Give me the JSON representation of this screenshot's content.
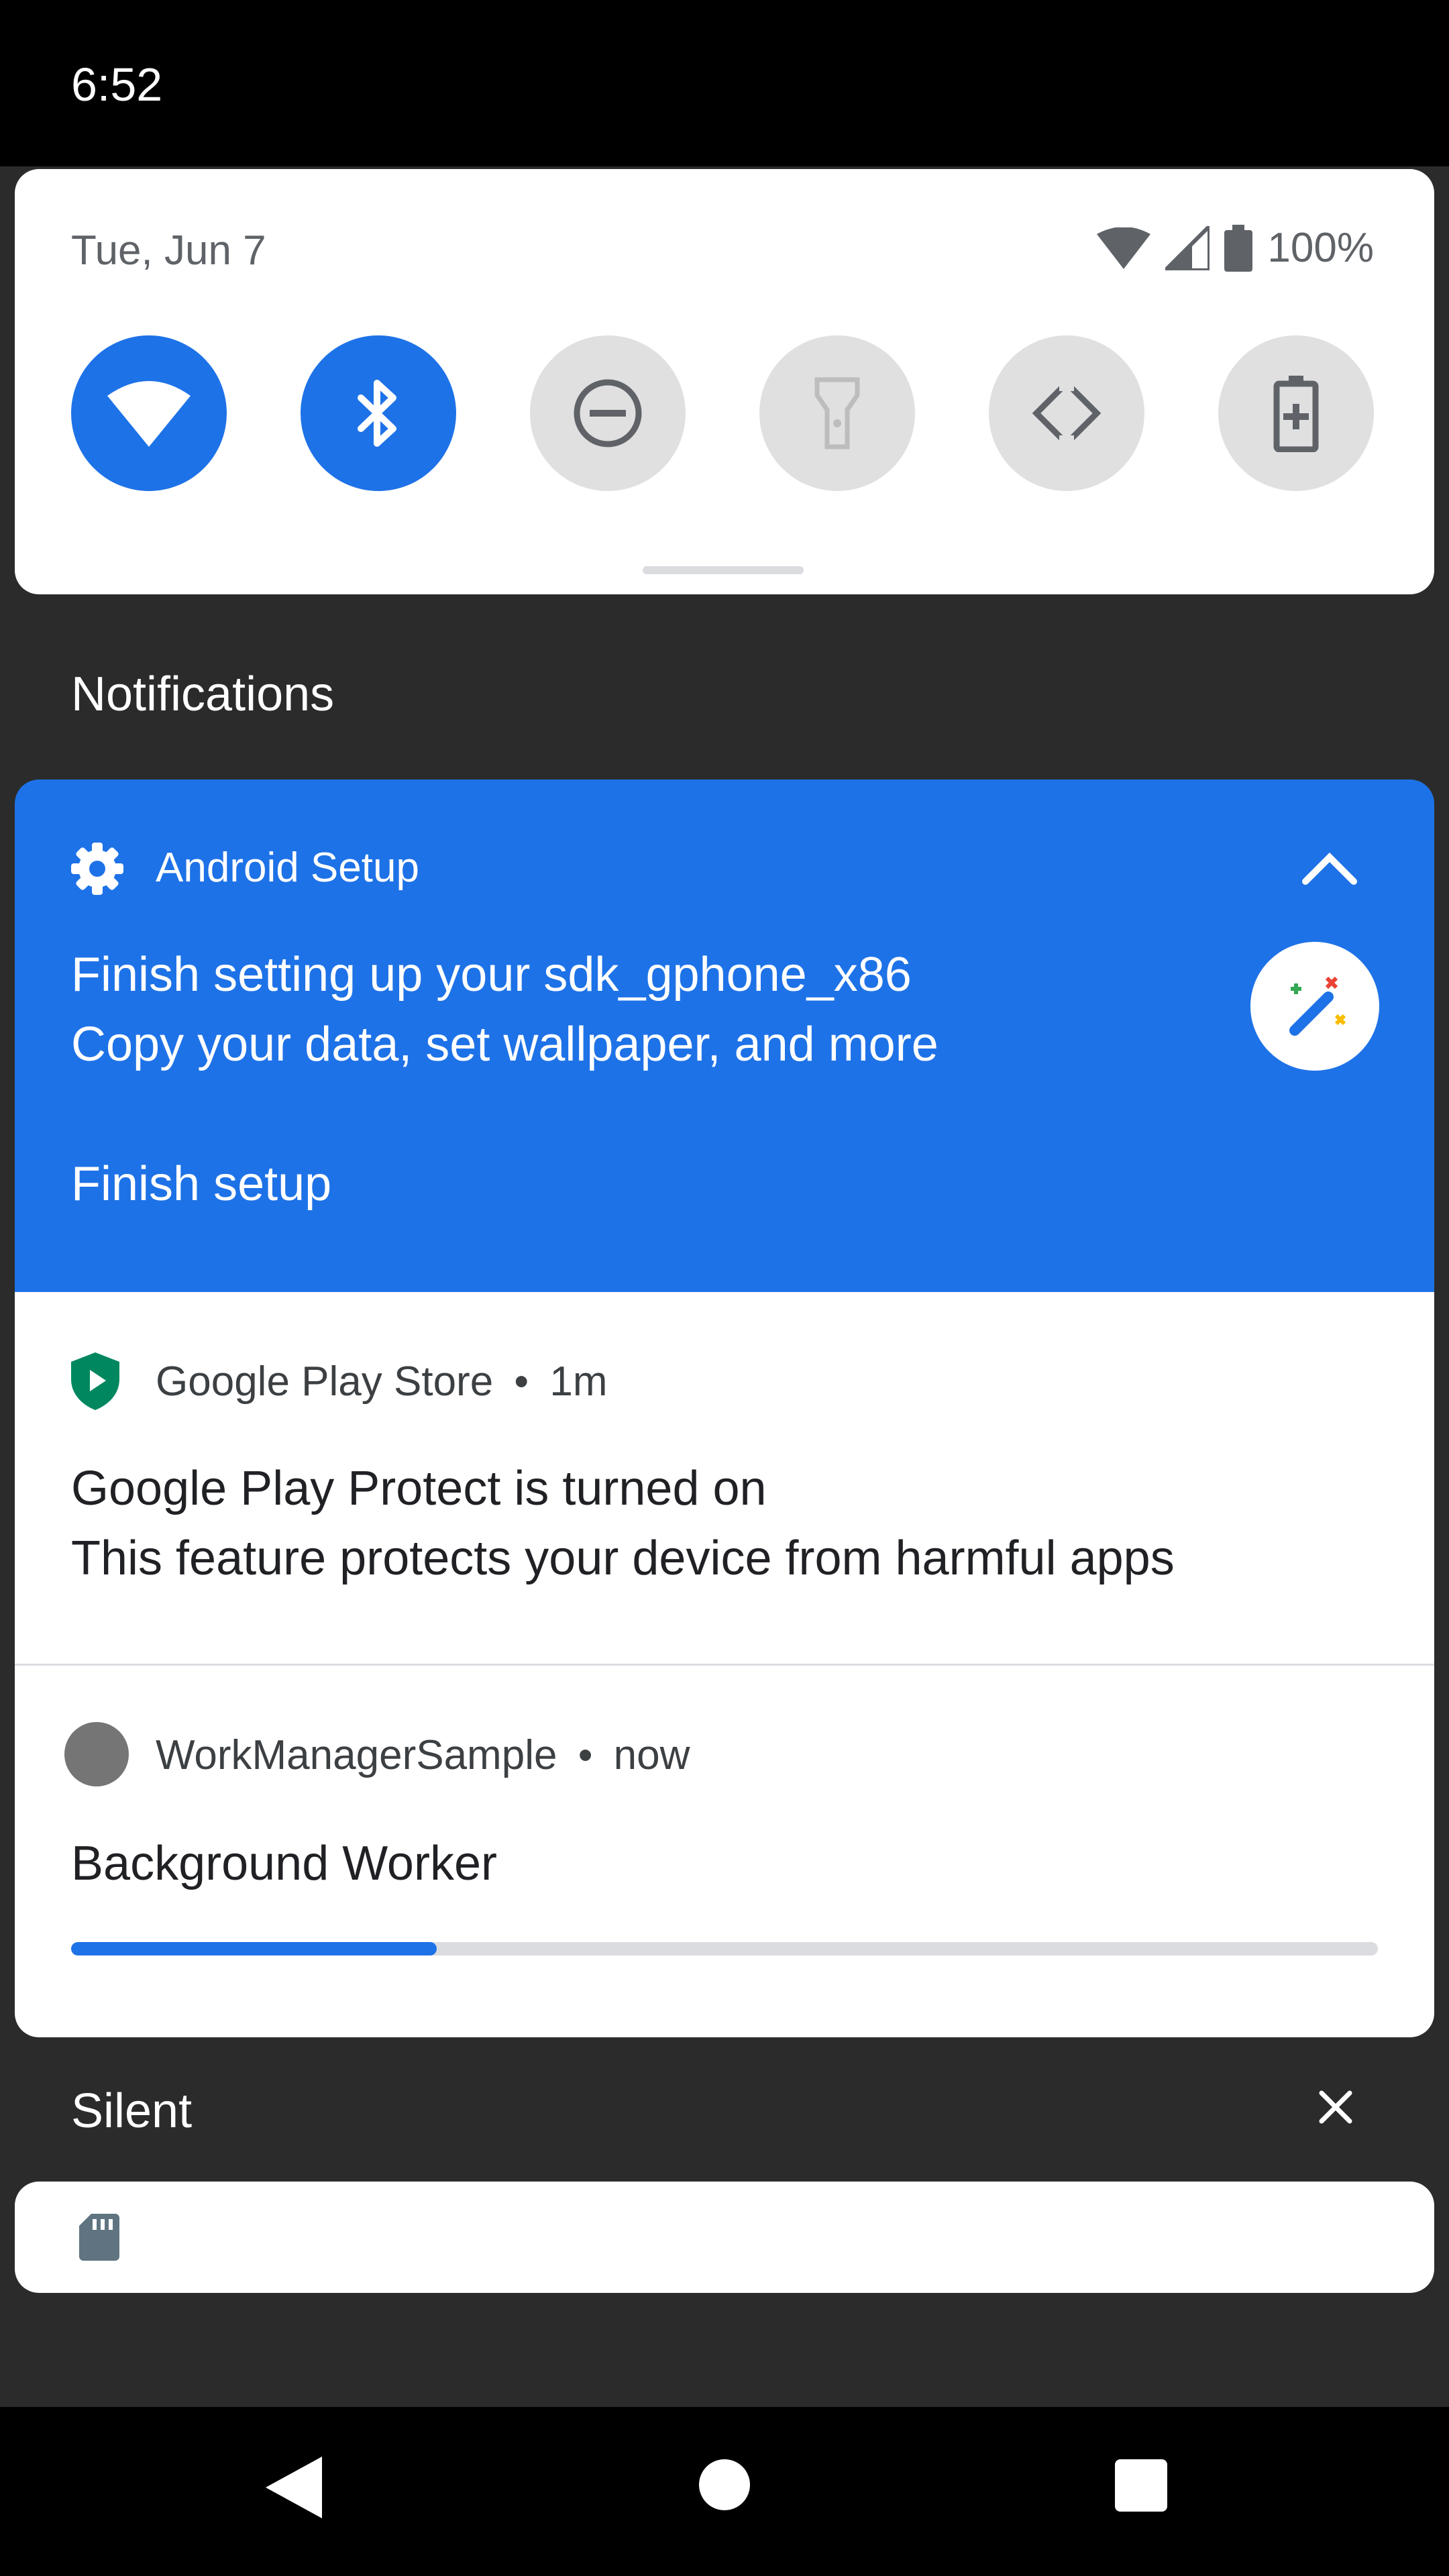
{
  "status_bar": {
    "time": "6:52"
  },
  "quick_settings": {
    "date": "Tue, Jun 7",
    "battery_percent": "100%",
    "tiles": [
      {
        "name": "wifi",
        "state": "on"
      },
      {
        "name": "bluetooth",
        "state": "on"
      },
      {
        "name": "do-not-disturb",
        "state": "off"
      },
      {
        "name": "flashlight",
        "state": "off"
      },
      {
        "name": "auto-rotate",
        "state": "off"
      },
      {
        "name": "battery-saver",
        "state": "off"
      }
    ]
  },
  "notifications_header": "Notifications",
  "setup_notification": {
    "app_name": "Android Setup",
    "title": "Finish setting up your sdk_gphone_x86",
    "text": "Copy your data, set wallpaper, and more",
    "action": "Finish setup",
    "icon": "gear-icon"
  },
  "play_notification": {
    "app_name": "Google Play Store",
    "separator": "•",
    "time": "1m",
    "title": "Google Play Protect is turned on",
    "text": "This feature protects your device from harmful apps"
  },
  "work_notification": {
    "app_name": "WorkManagerSample",
    "separator": "•",
    "time": "now",
    "title": "Background Worker",
    "progress": 0.28
  },
  "silent_section": {
    "label": "Silent"
  },
  "colors": {
    "accent": "#1e72e7",
    "tile_off": "#e0e0e0",
    "shade_bg": "#2b2b2b"
  }
}
